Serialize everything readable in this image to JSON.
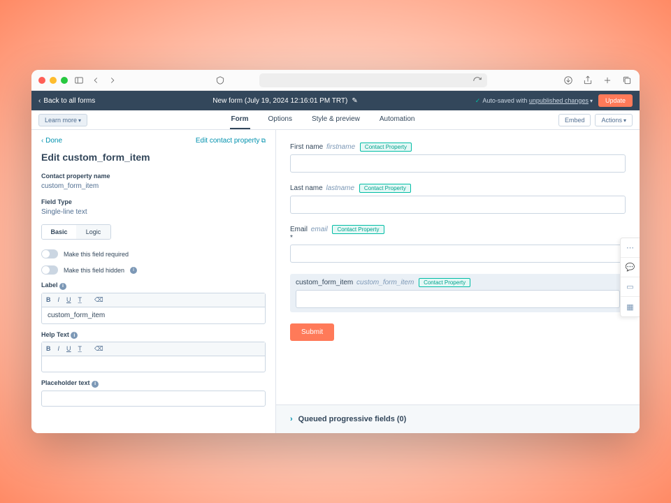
{
  "appbar": {
    "back": "Back to all forms",
    "title": "New form (July 19, 2024 12:16:01 PM TRT)",
    "autosave_prefix": "Auto-saved with ",
    "autosave_link": "unpublished changes",
    "update": "Update"
  },
  "subbar": {
    "learn": "Learn more",
    "tabs": [
      "Form",
      "Options",
      "Style & preview",
      "Automation"
    ],
    "embed": "Embed",
    "actions": "Actions"
  },
  "left": {
    "done": "Done",
    "edit_contact": "Edit contact property",
    "title": "Edit custom_form_item",
    "prop_name_label": "Contact property name",
    "prop_name_value": "custom_form_item",
    "field_type_label": "Field Type",
    "field_type_value": "Single-line text",
    "tab_basic": "Basic",
    "tab_logic": "Logic",
    "toggle_required": "Make this field required",
    "toggle_hidden": "Make this field hidden",
    "label_label": "Label",
    "label_value": "custom_form_item",
    "help_label": "Help Text",
    "placeholder_label": "Placeholder text"
  },
  "preview": {
    "fields": [
      {
        "label": "First name",
        "slug": "firstname",
        "badge": "Contact Property",
        "required": false
      },
      {
        "label": "Last name",
        "slug": "lastname",
        "badge": "Contact Property",
        "required": false
      },
      {
        "label": "Email",
        "slug": "email",
        "badge": "Contact Property",
        "required": true
      },
      {
        "label": "custom_form_item",
        "slug": "custom_form_item",
        "badge": "Contact Property",
        "required": false,
        "selected": true
      }
    ],
    "submit": "Submit",
    "queued": "Queued progressive fields (0)"
  }
}
